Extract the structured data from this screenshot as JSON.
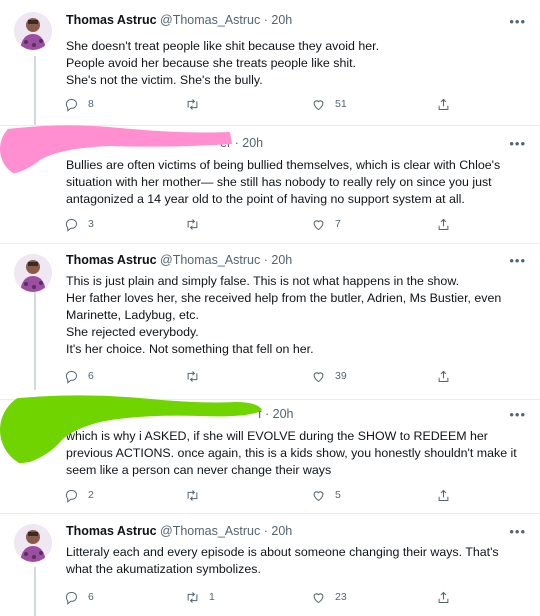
{
  "tweets": [
    {
      "name": "Thomas Astruc",
      "handle": "@Thomas_Astruc",
      "dot": "·",
      "time": "20h",
      "more": "•••",
      "lines": [
        "She doesn't treat people like shit because they avoid her.",
        "People avoid her because she treats people like shit.",
        "She's not the victim. She's the bully."
      ],
      "replies": "8",
      "retweets": "",
      "likes": "51"
    },
    {
      "name": "",
      "handle": "",
      "dot": "·",
      "time": "20h",
      "header_visible_fragment": "er",
      "more": "•••",
      "lines": [
        "Bullies are often victims of being bullied themselves, which is clear with Chloe's",
        "situation with her mother— she still has nobody to really rely on since you just",
        "antagonized a 14 year old to the point of having no support system at all."
      ],
      "replies": "3",
      "retweets": "",
      "likes": "7"
    },
    {
      "name": "Thomas Astruc",
      "handle": "@Thomas_Astruc",
      "dot": "·",
      "time": "20h",
      "more": "•••",
      "lines": [
        "This is just plain and simply false. This is not what happens in the show.",
        "Her father loves her, she received help from the butler, Adrien, Ms Bustier, even",
        "Marinette, Ladybug, etc.",
        "She rejected everybody.",
        "It's her choice. Not something that fell on her."
      ],
      "replies": "6",
      "retweets": "",
      "likes": "39"
    },
    {
      "name": "",
      "handle": "",
      "dot": "·",
      "time": "20h",
      "header_visible_fragment": "f",
      "more": "•••",
      "lines": [
        "which is why i ASKED, if she will EVOLVE during the SHOW to REDEEM her",
        "previous ACTIONS. once again, this is a kids show, you honestly shouldn't make it",
        "seem like a person can never change their ways"
      ],
      "replies": "2",
      "retweets": "",
      "likes": "5"
    },
    {
      "name": "Thomas Astruc",
      "handle": "@Thomas_Astruc",
      "dot": "·",
      "time": "20h",
      "more": "•••",
      "lines": [
        "Litteraly each and every episode is about someone changing their ways. That's",
        "what the akumatization  symbolizes."
      ],
      "replies": "6",
      "retweets": "1",
      "likes": "23"
    }
  ],
  "colors": {
    "text": "#0f1419",
    "muted": "#536471",
    "pink_scribble": "#ff8fd0",
    "green_scribble": "#6fd400"
  },
  "icons": [
    "avatar",
    "more-icon",
    "reply-icon",
    "retweet-icon",
    "like-icon",
    "share-icon"
  ]
}
